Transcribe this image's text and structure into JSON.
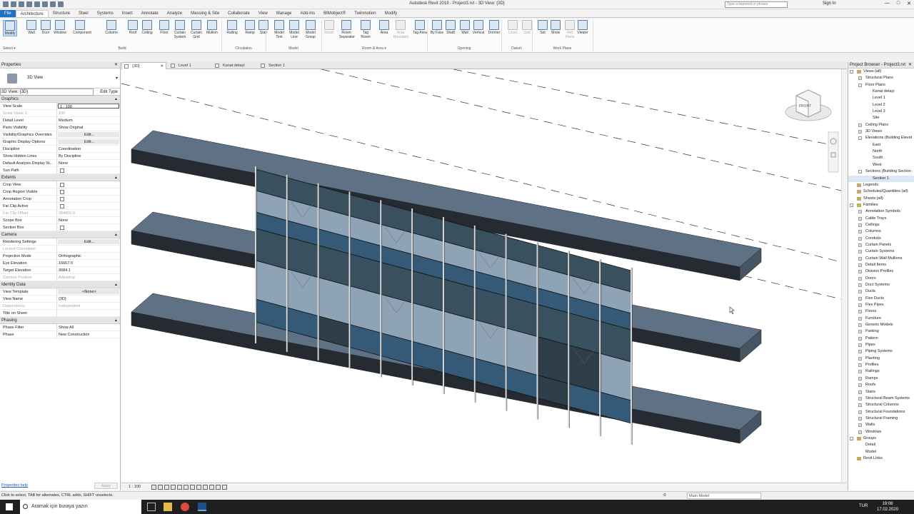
{
  "title_bar": {
    "title": "Autodesk Revit 2019 - Project3.rvt - 3D View: {3D}",
    "search_placeholder": "Type a keyword or phrase",
    "sign_in": "Sign In"
  },
  "menu": [
    "File",
    "Architecture",
    "Structure",
    "Steel",
    "Systems",
    "Insert",
    "Annotate",
    "Analyze",
    "Massing & Site",
    "Collaborate",
    "View",
    "Manage",
    "Add-Ins",
    "BIMobject®",
    "Twinmotion",
    "Modify"
  ],
  "menu_active": "Architecture",
  "ribbon": {
    "select_label": "Select ▾",
    "tools": [
      {
        "label": "Modify"
      },
      {
        "label": "Wall"
      },
      {
        "label": "Door"
      },
      {
        "label": "Window"
      },
      {
        "label": "Component"
      },
      {
        "label": "Column"
      },
      {
        "label": "Roof"
      },
      {
        "label": "Ceiling"
      },
      {
        "label": "Floor"
      },
      {
        "label": "Curtain System"
      },
      {
        "label": "Curtain Grid"
      },
      {
        "label": "Mullion"
      },
      {
        "label": "Railing"
      },
      {
        "label": "Ramp"
      },
      {
        "label": "Stair"
      },
      {
        "label": "Model Text"
      },
      {
        "label": "Model Line"
      },
      {
        "label": "Model Group"
      },
      {
        "label": "Room"
      },
      {
        "label": "Room Separator"
      },
      {
        "label": "Tag Room"
      },
      {
        "label": "Area"
      },
      {
        "label": "Area Boundary"
      },
      {
        "label": "Tag Area"
      },
      {
        "label": "By Face"
      },
      {
        "label": "Shaft"
      },
      {
        "label": "Wall"
      },
      {
        "label": "Vertical"
      },
      {
        "label": "Dormer"
      },
      {
        "label": "Level"
      },
      {
        "label": "Grid"
      },
      {
        "label": "Set"
      },
      {
        "label": "Show"
      },
      {
        "label": "Ref Plane"
      },
      {
        "label": "Viewer"
      }
    ],
    "panels": [
      "Build",
      "Circulation",
      "Model",
      "Room & Area ▾",
      "Opening",
      "Datum",
      "Work Plane"
    ]
  },
  "properties": {
    "header": "Properties",
    "type_name": "3D View",
    "selector": "3D View: {3D}",
    "edit_type": "Edit Type",
    "groups": [
      {
        "name": "Graphics",
        "rows": [
          {
            "k": "View Scale",
            "v": "1 : 100",
            "style": "input"
          },
          {
            "k": "Scale Value    1:",
            "v": "100",
            "style": "dis"
          },
          {
            "k": "Detail Level",
            "v": "Medium"
          },
          {
            "k": "Parts Visibility",
            "v": "Show Original"
          },
          {
            "k": "Visibility/Graphics Overrides",
            "v": "Edit...",
            "style": "btn"
          },
          {
            "k": "Graphic Display Options",
            "v": "Edit...",
            "style": "btn"
          },
          {
            "k": "Discipline",
            "v": "Coordination"
          },
          {
            "k": "Show Hidden Lines",
            "v": "By Discipline"
          },
          {
            "k": "Default Analysis Display St...",
            "v": "None"
          },
          {
            "k": "Sun Path",
            "v": "",
            "style": "cb"
          }
        ]
      },
      {
        "name": "Extents",
        "rows": [
          {
            "k": "Crop View",
            "v": "",
            "style": "cb"
          },
          {
            "k": "Crop Region Visible",
            "v": "",
            "style": "cb"
          },
          {
            "k": "Annotation Crop",
            "v": "",
            "style": "cb"
          },
          {
            "k": "Far Clip Active",
            "v": "",
            "style": "cb"
          },
          {
            "k": "Far Clip Offset",
            "v": "304800.0",
            "style": "dis"
          },
          {
            "k": "Scope Box",
            "v": "None"
          },
          {
            "k": "Section Box",
            "v": "",
            "style": "cb"
          }
        ]
      },
      {
        "name": "Camera",
        "rows": [
          {
            "k": "Rendering Settings",
            "v": "Edit...",
            "style": "btn"
          },
          {
            "k": "Locked Orientation",
            "v": "",
            "style": "dis"
          },
          {
            "k": "Projection Mode",
            "v": "Orthographic"
          },
          {
            "k": "Eye Elevation",
            "v": "16667.0"
          },
          {
            "k": "Target Elevation",
            "v": "3084.1"
          },
          {
            "k": "Camera Position",
            "v": "Adjusting",
            "style": "dis"
          }
        ]
      },
      {
        "name": "Identity Data",
        "rows": [
          {
            "k": "View Template",
            "v": "<None>",
            "style": "btn"
          },
          {
            "k": "View Name",
            "v": "{3D}"
          },
          {
            "k": "Dependency",
            "v": "Independent",
            "style": "dis"
          },
          {
            "k": "Title on Sheet",
            "v": ""
          }
        ]
      },
      {
        "name": "Phasing",
        "rows": [
          {
            "k": "Phase Filter",
            "v": "Show All"
          },
          {
            "k": "Phase",
            "v": "New Construction"
          }
        ]
      }
    ],
    "help": "Properties help",
    "apply": "Apply"
  },
  "view_tabs": [
    {
      "label": "{3D}",
      "active": true
    },
    {
      "label": "Level 1"
    },
    {
      "label": "Kanat detayi"
    },
    {
      "label": "Section 1"
    }
  ],
  "view_control": {
    "scale": "1 : 100"
  },
  "viewcube": {
    "face": "FRONT"
  },
  "project_browser": {
    "header": "Project Browser - Project3.rvt",
    "items": [
      {
        "t": "Views (all)",
        "lvl": 0,
        "tog": "-",
        "icon": true
      },
      {
        "t": "Structural Plans",
        "lvl": 1,
        "tog": "+"
      },
      {
        "t": "Floor Plans",
        "lvl": 1,
        "tog": "-"
      },
      {
        "t": "Kanat detayi",
        "lvl": 2
      },
      {
        "t": "Level 1",
        "lvl": 2
      },
      {
        "t": "Level 2",
        "lvl": 2
      },
      {
        "t": "Level 3",
        "lvl": 2
      },
      {
        "t": "Site",
        "lvl": 2
      },
      {
        "t": "Ceiling Plans",
        "lvl": 1,
        "tog": "+"
      },
      {
        "t": "3D Views",
        "lvl": 1,
        "tog": "+"
      },
      {
        "t": "Elevations (Building Elevat",
        "lvl": 1,
        "tog": "-"
      },
      {
        "t": "East",
        "lvl": 2
      },
      {
        "t": "North",
        "lvl": 2
      },
      {
        "t": "South",
        "lvl": 2
      },
      {
        "t": "West",
        "lvl": 2
      },
      {
        "t": "Sections (Building Section",
        "lvl": 1,
        "tog": "-"
      },
      {
        "t": "Section 1",
        "lvl": 2,
        "hl": true
      },
      {
        "t": "Legends",
        "lvl": 0,
        "icon": true
      },
      {
        "t": "Schedules/Quantities (all)",
        "lvl": 0,
        "icon": true
      },
      {
        "t": "Sheets (all)",
        "lvl": 0,
        "icon": true
      },
      {
        "t": "Families",
        "lvl": 0,
        "tog": "-",
        "icon": true
      },
      {
        "t": "Annotation Symbols",
        "lvl": 1,
        "tog": "+"
      },
      {
        "t": "Cable Trays",
        "lvl": 1,
        "tog": "+"
      },
      {
        "t": "Ceilings",
        "lvl": 1,
        "tog": "+"
      },
      {
        "t": "Columns",
        "lvl": 1,
        "tog": "+"
      },
      {
        "t": "Conduits",
        "lvl": 1,
        "tog": "+"
      },
      {
        "t": "Curtain Panels",
        "lvl": 1,
        "tog": "+"
      },
      {
        "t": "Curtain Systems",
        "lvl": 1,
        "tog": "+"
      },
      {
        "t": "Curtain Wall Mullions",
        "lvl": 1,
        "tog": "+"
      },
      {
        "t": "Detail Items",
        "lvl": 1,
        "tog": "+"
      },
      {
        "t": "Division Profiles",
        "lvl": 1,
        "tog": "+"
      },
      {
        "t": "Doors",
        "lvl": 1,
        "tog": "+"
      },
      {
        "t": "Duct Systems",
        "lvl": 1,
        "tog": "+"
      },
      {
        "t": "Ducts",
        "lvl": 1,
        "tog": "+"
      },
      {
        "t": "Flex Ducts",
        "lvl": 1,
        "tog": "+"
      },
      {
        "t": "Flex Pipes",
        "lvl": 1,
        "tog": "+"
      },
      {
        "t": "Floors",
        "lvl": 1,
        "tog": "+"
      },
      {
        "t": "Furniture",
        "lvl": 1,
        "tog": "+"
      },
      {
        "t": "Generic Models",
        "lvl": 1,
        "tog": "+"
      },
      {
        "t": "Parking",
        "lvl": 1,
        "tog": "+"
      },
      {
        "t": "Pattern",
        "lvl": 1,
        "tog": "+"
      },
      {
        "t": "Pipes",
        "lvl": 1,
        "tog": "+"
      },
      {
        "t": "Piping Systems",
        "lvl": 1,
        "tog": "+"
      },
      {
        "t": "Planting",
        "lvl": 1,
        "tog": "+"
      },
      {
        "t": "Profiles",
        "lvl": 1,
        "tog": "+"
      },
      {
        "t": "Railings",
        "lvl": 1,
        "tog": "+"
      },
      {
        "t": "Ramps",
        "lvl": 1,
        "tog": "+"
      },
      {
        "t": "Roofs",
        "lvl": 1,
        "tog": "+"
      },
      {
        "t": "Stairs",
        "lvl": 1,
        "tog": "+"
      },
      {
        "t": "Structural Beam Systems",
        "lvl": 1,
        "tog": "+"
      },
      {
        "t": "Structural Columns",
        "lvl": 1,
        "tog": "+"
      },
      {
        "t": "Structural Foundations",
        "lvl": 1,
        "tog": "+"
      },
      {
        "t": "Structural Framing",
        "lvl": 1,
        "tog": "+"
      },
      {
        "t": "Walls",
        "lvl": 1,
        "tog": "+"
      },
      {
        "t": "Windows",
        "lvl": 1,
        "tog": "+"
      },
      {
        "t": "Groups",
        "lvl": 0,
        "tog": "-",
        "icon": true
      },
      {
        "t": "Detail",
        "lvl": 1
      },
      {
        "t": "Model",
        "lvl": 1
      },
      {
        "t": "Revit Links",
        "lvl": 0,
        "icon": true
      }
    ]
  },
  "status_bar": {
    "message": "Click to select, TAB for alternates, CTRL adds, SHIFT unselects.",
    "zero": ":0",
    "model": "Main Model"
  },
  "taskbar": {
    "search": "Aramak için buraya yazın",
    "lang": "TUR",
    "time": "19:08",
    "date": "17.02.2020"
  },
  "colors": {
    "slab_top": "#5e7185",
    "slab_side": "#262b32",
    "glass_light": "#8fa3b6",
    "glass_dark": "#39505f",
    "glass_blue": "#345a78",
    "accent": "#1e72c4"
  }
}
